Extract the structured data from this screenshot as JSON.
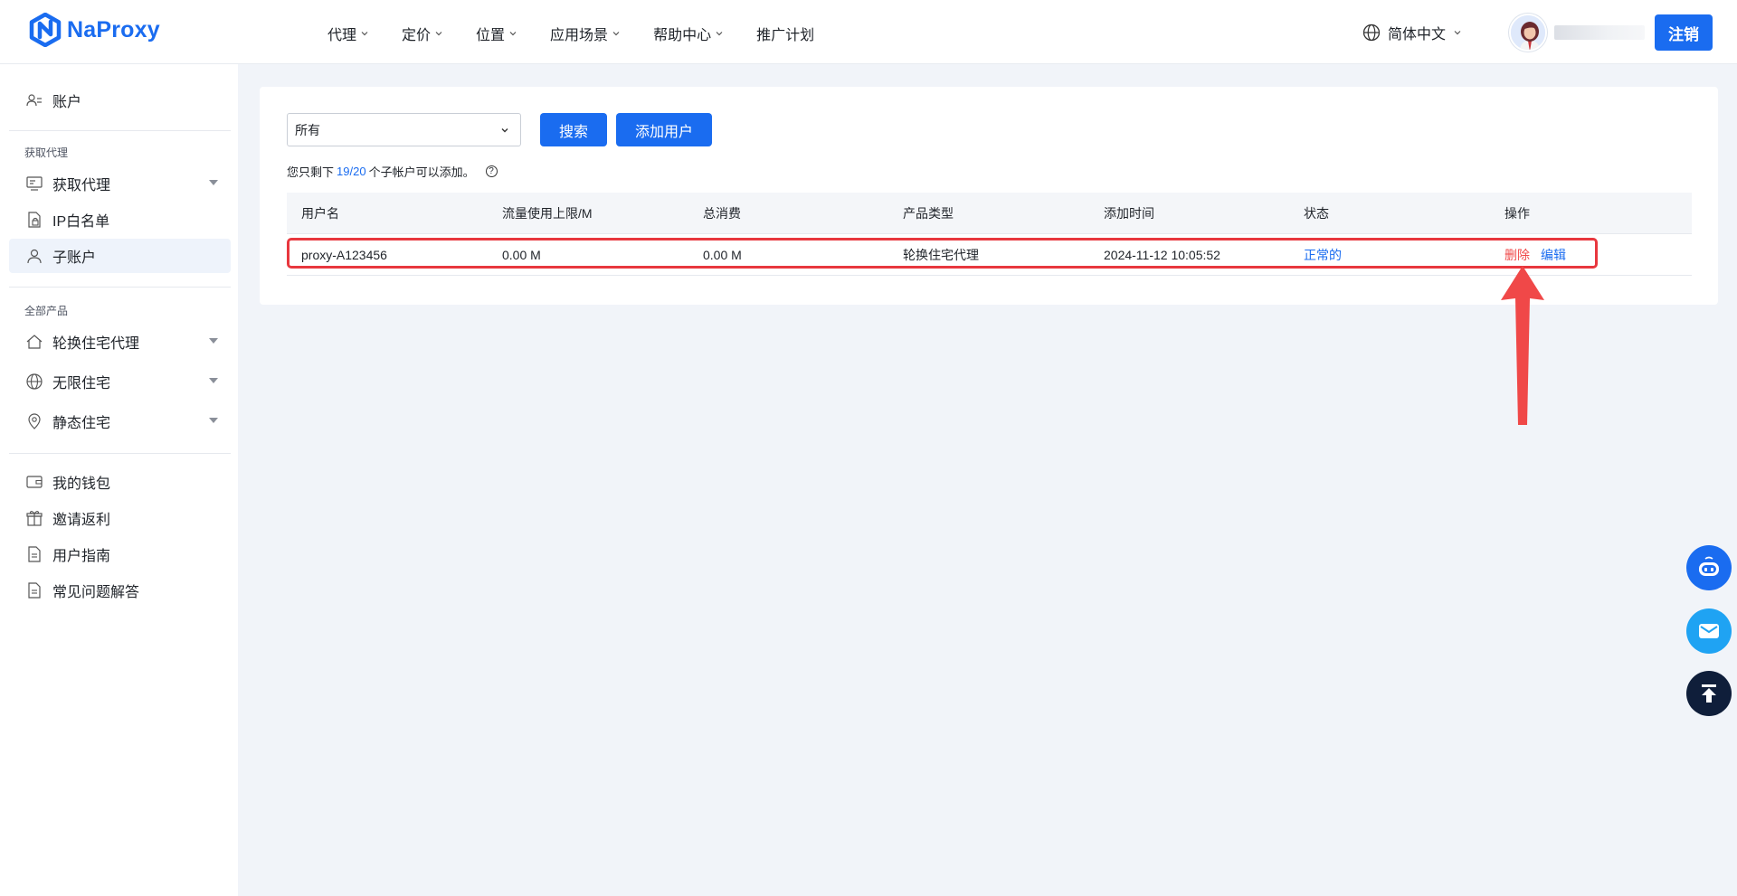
{
  "brand": {
    "name": "NaProxy",
    "color": "#1a6cf0"
  },
  "nav": {
    "items": [
      {
        "label": "代理",
        "has_dropdown": true
      },
      {
        "label": "定价",
        "has_dropdown": true
      },
      {
        "label": "位置",
        "has_dropdown": true
      },
      {
        "label": "应用场景",
        "has_dropdown": true
      },
      {
        "label": "帮助中心",
        "has_dropdown": true
      },
      {
        "label": "推广计划",
        "has_dropdown": false
      }
    ]
  },
  "header": {
    "language": "简体中文",
    "logout_label": "注销"
  },
  "sidebar": {
    "account": "账户",
    "group_get_proxy": "获取代理",
    "get_proxy": "获取代理",
    "ip_whitelist": "IP白名单",
    "sub_account": "子账户",
    "group_all_products": "全部产品",
    "rotating_residential": "轮换住宅代理",
    "unlimited_residential": "无限住宅",
    "static_residential": "静态住宅",
    "wallet": "我的钱包",
    "invite": "邀请返利",
    "user_guide": "用户指南",
    "faq": "常见问题解答",
    "active_item": "子账户"
  },
  "main": {
    "filter_select_value": "所有",
    "search_label": "搜索",
    "add_user_label": "添加用户",
    "notice_prefix": "您只剩下",
    "notice_count": "19/20",
    "notice_suffix": "个子帐户可以添加。",
    "table": {
      "headers": {
        "username": "用户名",
        "traffic_limit": "流量使用上限/M",
        "total_consumption": "总消费",
        "product_type": "产品类型",
        "added_time": "添加时间",
        "status": "状态",
        "actions": "操作"
      },
      "rows": [
        {
          "username": "proxy-A123456",
          "traffic_limit": "0.00 M",
          "total_consumption": "0.00 M",
          "product_type": "轮换住宅代理",
          "added_time": "2024-11-12 10:05:52",
          "status": "正常的",
          "delete_label": "删除",
          "edit_label": "编辑"
        }
      ]
    }
  },
  "colors": {
    "primary": "#1a6cf0",
    "danger": "#f04848",
    "annotation": "#e8373e",
    "background": "#f1f4f9"
  },
  "floating_buttons": [
    "robot-chat-icon",
    "mail-icon",
    "back-to-top-icon"
  ]
}
